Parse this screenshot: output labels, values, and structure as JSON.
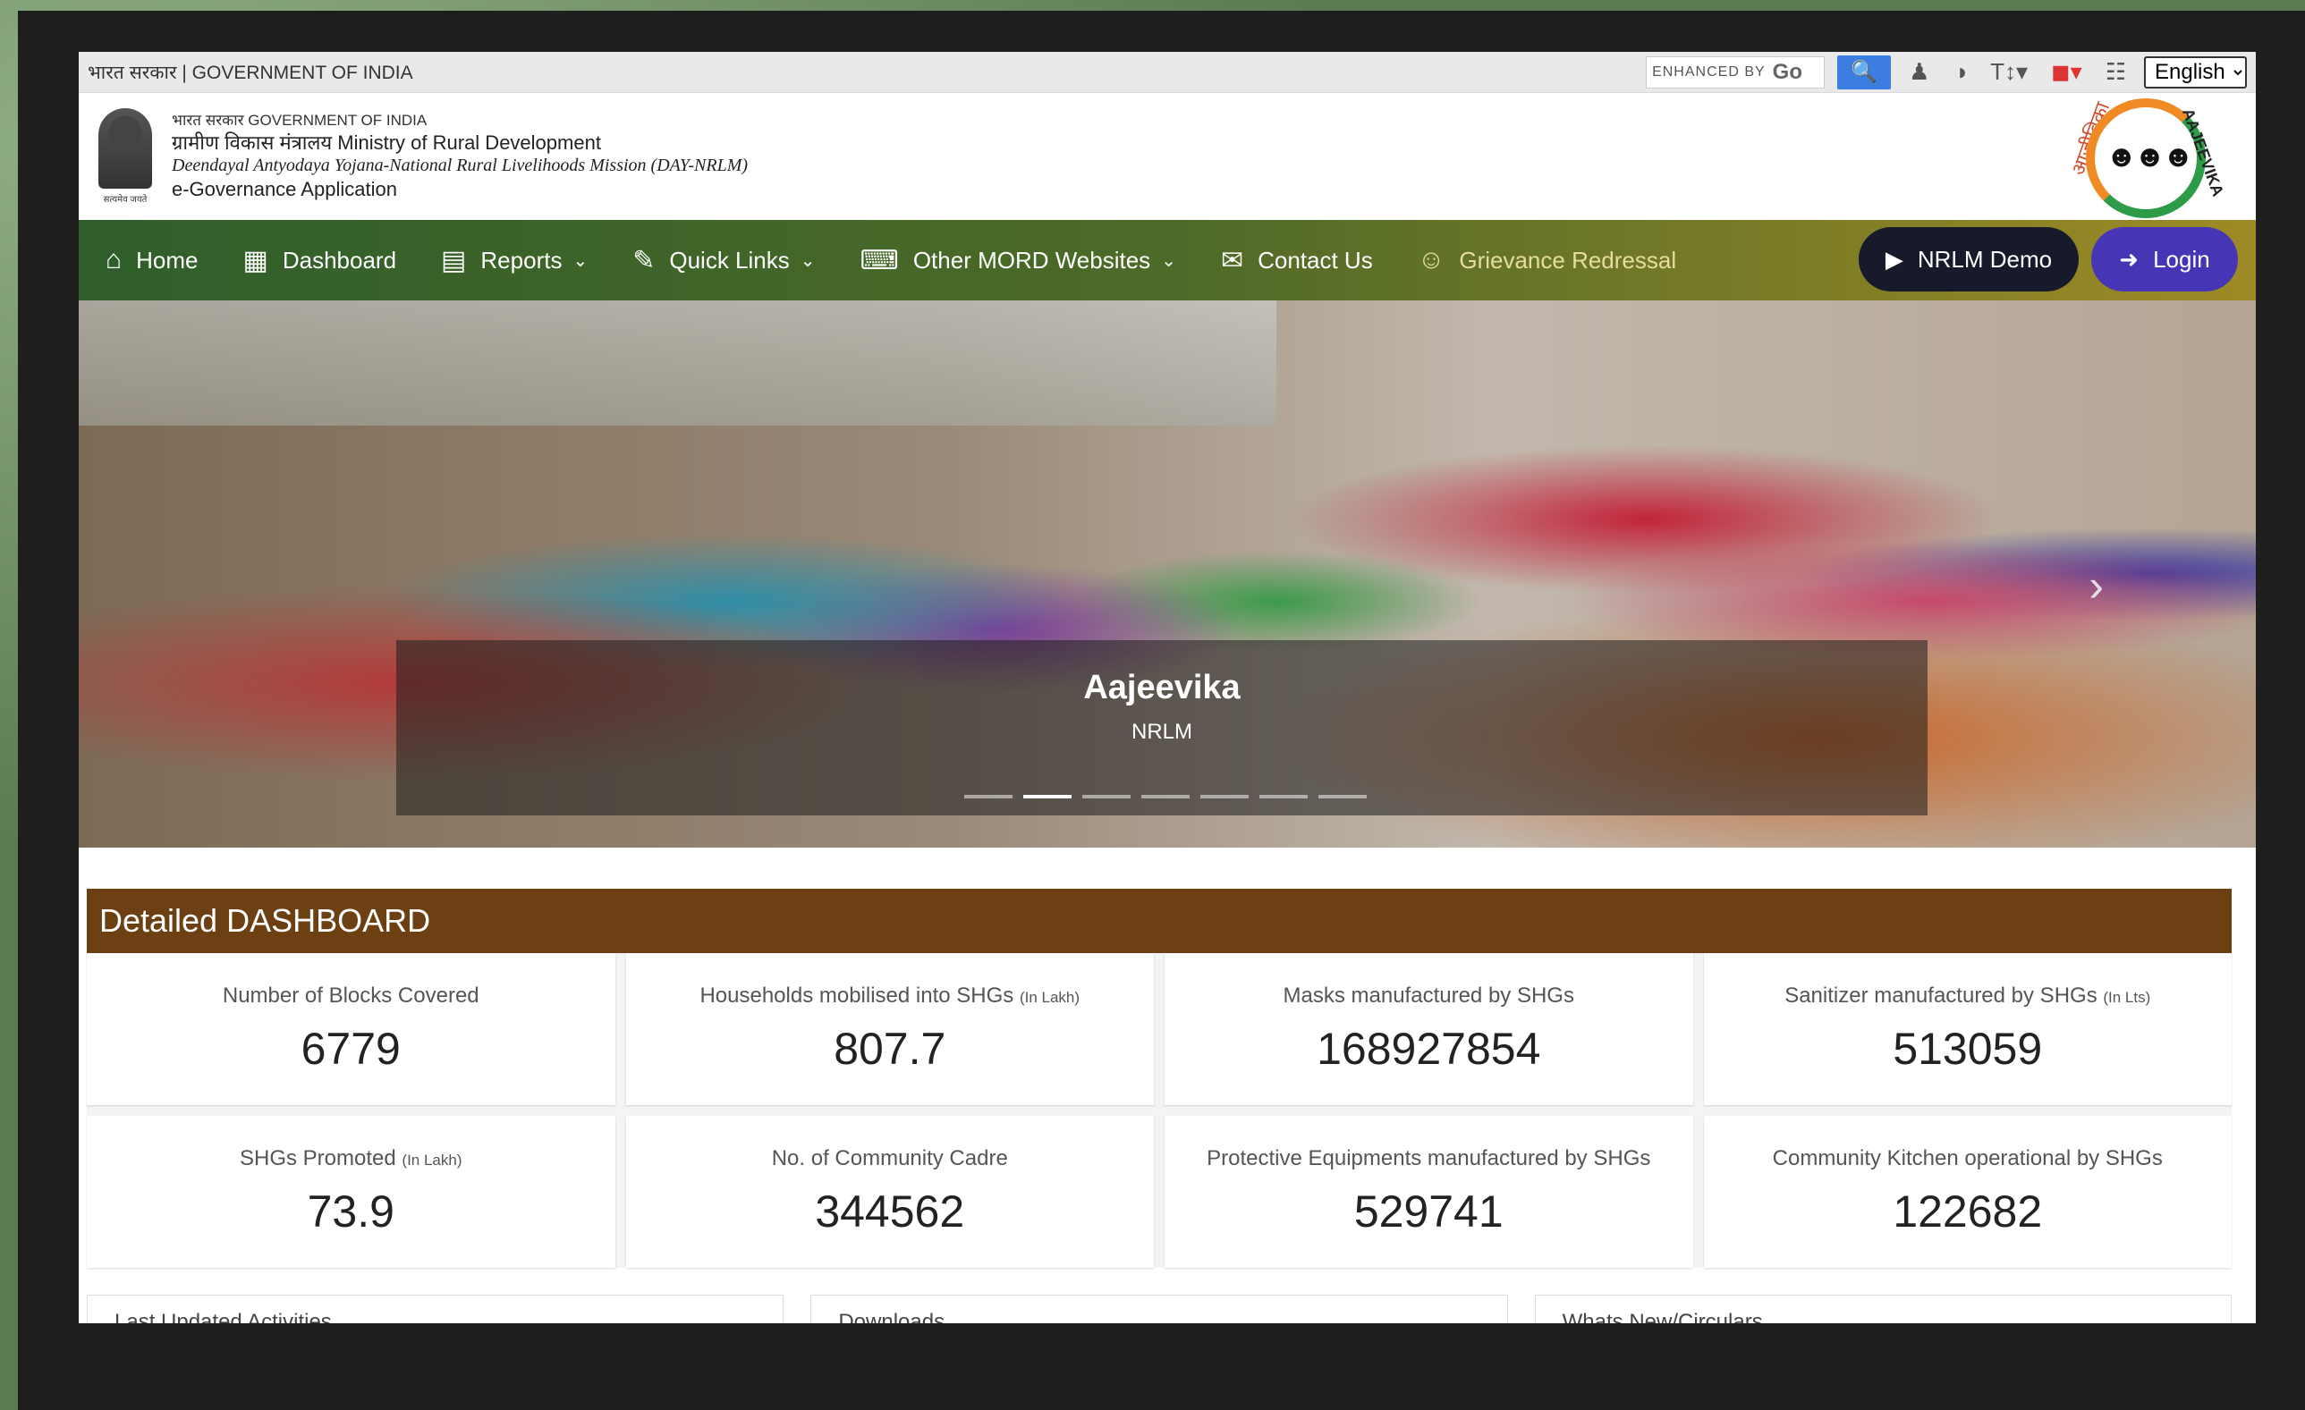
{
  "topbar": {
    "gov_label": "भारत सरकार | GOVERNMENT OF INDIA",
    "search_label": "ENHANCED BY",
    "search_brand": "Go",
    "language": "English"
  },
  "header": {
    "line1": "भारत सरकार  GOVERNMENT OF INDIA",
    "line2": "ग्रामीण विकास मंत्रालय  Ministry of Rural Development",
    "line3": "Deendayal Antyodaya Yojana-National Rural Livelihoods Mission (DAY-NRLM)",
    "line4": "e-Governance Application",
    "emblem_motto": "सत्यमेव जयते",
    "logo_side_left": "आजीविका",
    "logo_side_right": "AAJEEVIKA"
  },
  "nav": {
    "items": [
      {
        "label": "Home",
        "icon": "home-icon"
      },
      {
        "label": "Dashboard",
        "icon": "dashboard-icon"
      },
      {
        "label": "Reports",
        "icon": "reports-icon"
      },
      {
        "label": "Quick Links",
        "icon": "quick-links-icon"
      },
      {
        "label": "Other MORD Websites",
        "icon": "websites-icon"
      },
      {
        "label": "Contact Us",
        "icon": "contact-icon"
      },
      {
        "label": "Grievance Redressal",
        "icon": "grievance-icon"
      }
    ],
    "demo_label": "NRLM Demo",
    "login_label": "Login"
  },
  "hero": {
    "title": "Aajeevika",
    "subtitle": "NRLM",
    "slides": 7,
    "active_slide": 2
  },
  "dashboard": {
    "heading": "Detailed DASHBOARD",
    "cards": [
      {
        "label": "Number of Blocks Covered",
        "unit": "",
        "value": "6779"
      },
      {
        "label": "Households mobilised into SHGs",
        "unit": "(In Lakh)",
        "value": "807.7"
      },
      {
        "label": "Masks manufactured by SHGs",
        "unit": "",
        "value": "168927854"
      },
      {
        "label": "Sanitizer manufactured by SHGs",
        "unit": "(In Lts)",
        "value": "513059"
      },
      {
        "label": "SHGs Promoted",
        "unit": "(In Lakh)",
        "value": "73.9"
      },
      {
        "label": "No. of Community Cadre",
        "unit": "",
        "value": "344562"
      },
      {
        "label": "Protective Equipments manufactured by SHGs",
        "unit": "",
        "value": "529741"
      },
      {
        "label": "Community Kitchen operational by SHGs",
        "unit": "",
        "value": "122682"
      }
    ]
  },
  "panels": [
    "Last Updated Activities",
    "Downloads",
    "Whats New/Circulars"
  ]
}
